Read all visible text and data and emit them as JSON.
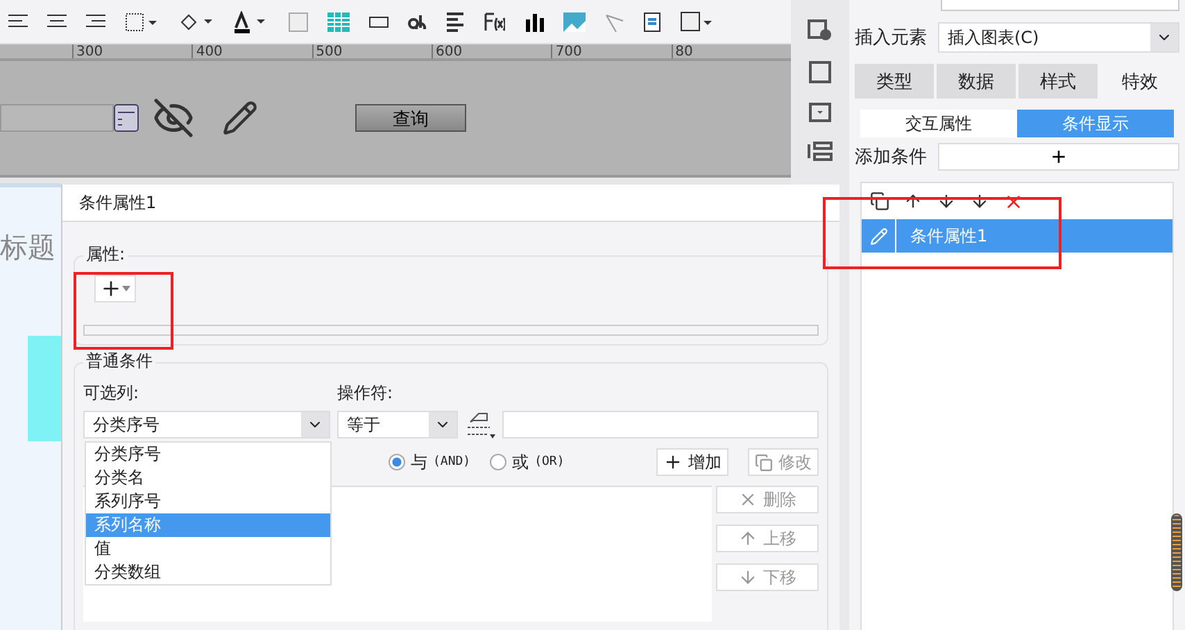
{
  "ruler": {
    "labels": [
      "300",
      "400",
      "500",
      "600",
      "700",
      "80"
    ]
  },
  "canvas": {
    "query_button": "查询"
  },
  "background_chart": {
    "title": "标题"
  },
  "sidebar": {
    "insert_label": "插入元素",
    "insert_select": "插入图表(C)",
    "tabs": [
      {
        "label": "类型",
        "selected": false
      },
      {
        "label": "数据",
        "selected": false
      },
      {
        "label": "样式",
        "selected": false
      },
      {
        "label": "特效",
        "selected": true
      }
    ],
    "subtabs": [
      {
        "label": "交互属性",
        "selected": false
      },
      {
        "label": "条件显示",
        "selected": true
      }
    ],
    "add_label": "添加条件",
    "add_button": "+",
    "conditions": [
      {
        "label": "条件属性1",
        "selected": true
      }
    ]
  },
  "dialog": {
    "title": "条件属性1",
    "attr_legend": "属性:",
    "section": "普通条件",
    "column_label": "可选列:",
    "column_value": "分类序号",
    "column_dropdown_expanded": true,
    "column_options": [
      {
        "label": "分类序号",
        "selected": false
      },
      {
        "label": "分类名",
        "selected": false
      },
      {
        "label": "系列序号",
        "selected": false
      },
      {
        "label": "系列名称",
        "selected": true
      },
      {
        "label": "值",
        "selected": false
      },
      {
        "label": "分类数组",
        "selected": false
      }
    ],
    "operator_label": "操作符:",
    "operator_value": "等于",
    "logic": [
      {
        "label": "与",
        "code": "(AND)",
        "selected": true
      },
      {
        "label": "或",
        "code": "(OR)",
        "selected": false
      }
    ],
    "actions": [
      {
        "kind": "add",
        "label": "增加",
        "disabled": false
      },
      {
        "kind": "edit",
        "label": "修改",
        "disabled": true
      }
    ],
    "side_actions": [
      {
        "kind": "delete",
        "label": "删除",
        "disabled": true
      },
      {
        "kind": "up",
        "label": "上移",
        "disabled": true
      },
      {
        "kind": "down",
        "label": "下移",
        "disabled": true
      }
    ]
  }
}
